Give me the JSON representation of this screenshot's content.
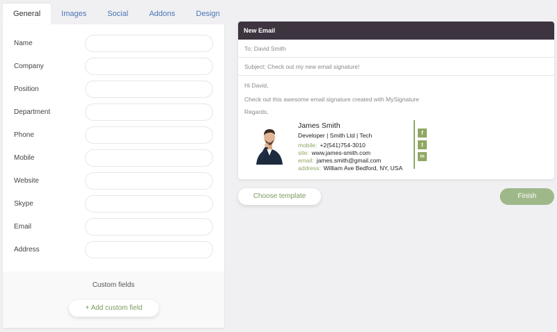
{
  "tabs": [
    {
      "label": "General",
      "active": true
    },
    {
      "label": "Images"
    },
    {
      "label": "Social"
    },
    {
      "label": "Addons"
    },
    {
      "label": "Design"
    }
  ],
  "form": {
    "fields": [
      {
        "label": "Name",
        "value": ""
      },
      {
        "label": "Company",
        "value": ""
      },
      {
        "label": "Position",
        "value": ""
      },
      {
        "label": "Department",
        "value": ""
      },
      {
        "label": "Phone",
        "value": ""
      },
      {
        "label": "Mobile",
        "value": ""
      },
      {
        "label": "Website",
        "value": ""
      },
      {
        "label": "Skype",
        "value": ""
      },
      {
        "label": "Email",
        "value": ""
      },
      {
        "label": "Address",
        "value": ""
      }
    ],
    "custom_fields_title": "Custom fields",
    "add_custom_label": "+ Add custom field"
  },
  "email": {
    "header": "New Email",
    "to": "To: David Smith",
    "subject": "Subject: Check out my new email signature!",
    "greeting": "Hi David,",
    "message": "Check out this awesome email signature created with MySignature",
    "regards": "Regards,"
  },
  "signature": {
    "name": "James Smith",
    "title": "Developer | Smith Ltd | Tech",
    "rows": [
      {
        "key": "mobile:",
        "value": "+2(541)754-3010"
      },
      {
        "key": "site:",
        "value": "www.james-smith.com"
      },
      {
        "key": "email:",
        "value": "james.smith@gmail.com"
      },
      {
        "key": "address:",
        "value": "William Ave Bedford, NY, USA"
      }
    ],
    "social": [
      {
        "icon": "facebook-icon",
        "glyph": "f"
      },
      {
        "icon": "twitter-icon",
        "glyph": "t"
      },
      {
        "icon": "linkedin-icon",
        "glyph": "in"
      }
    ],
    "accent_color": "#8ea864"
  },
  "actions": {
    "choose_template": "Choose template",
    "finish": "Finish"
  },
  "colors": {
    "header_bg": "#3d3440",
    "finish_bg": "#9fb88a",
    "link_tab": "#4a73b8"
  }
}
